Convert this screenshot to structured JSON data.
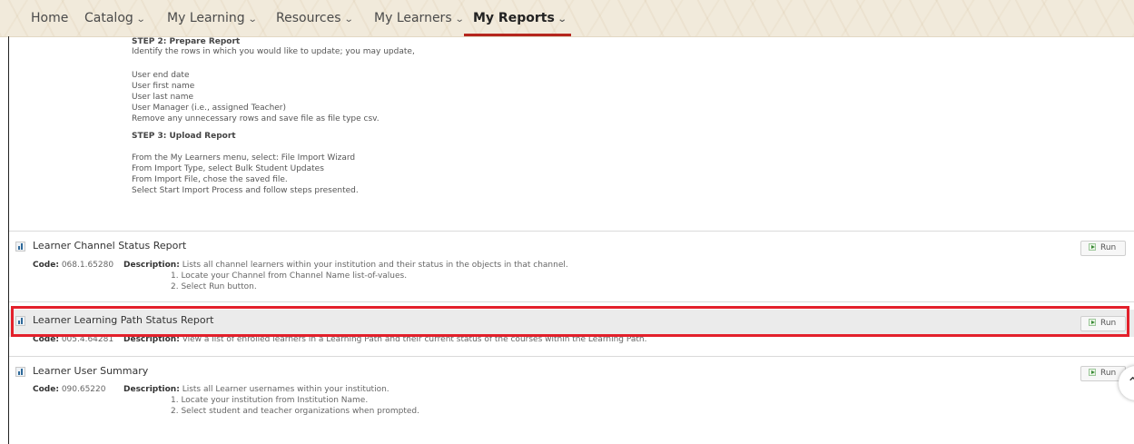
{
  "nav": {
    "items": [
      {
        "label": "Home",
        "dropdown": false,
        "active": false
      },
      {
        "label": "Catalog",
        "dropdown": true,
        "active": false
      },
      {
        "label": "My Learning",
        "dropdown": true,
        "active": false
      },
      {
        "label": "Resources",
        "dropdown": true,
        "active": false
      },
      {
        "label": "My Learners",
        "dropdown": true,
        "active": false
      },
      {
        "label": "My Reports",
        "dropdown": true,
        "active": true
      }
    ],
    "chevron": "⌄",
    "accent_color": "#b5261e"
  },
  "instructions": {
    "step2_title": "STEP 2: Prepare Report",
    "step2_intro": "Identify the rows in which you would like to update; you may update,",
    "fields": [
      "User end date",
      "User first name",
      "User last name",
      "User Manager (i.e., assigned Teacher)"
    ],
    "step2_outro": "Remove any unnecessary rows and save file as file type csv.",
    "step3_title": "STEP 3: Upload Report",
    "step3_lines": [
      "From the My Learners menu, select: File Import Wizard",
      "From Import Type, select Bulk Student Updates",
      "From Import File, chose the saved file.",
      "Select Start Import Process and follow steps presented."
    ]
  },
  "labels": {
    "code": "Code:",
    "description": "Description:",
    "run": "Run"
  },
  "reports": [
    {
      "title": "Learner Channel Status Report",
      "code": "068.1.65280",
      "description": "Lists all channel learners within your institution and their status in the objects in that channel.",
      "steps": [
        "1. Locate your Channel from Channel Name list-of-values.",
        "2. Select Run button."
      ],
      "highlighted": false
    },
    {
      "title": "Learner Learning Path Status Report",
      "code": "005.4.64281",
      "description": "View a list of enrolled learners in a Learning Path and their current status of the courses within the Learning Path.",
      "steps": [],
      "highlighted": true
    },
    {
      "title": "Learner User Summary",
      "code": "090.65220",
      "description": "Lists all Learner usernames within your institution.",
      "steps": [
        "1. Locate your institution from Institution Name.",
        "2. Select student and teacher organizations when prompted."
      ],
      "highlighted": false
    }
  ],
  "icons": {
    "report": "report-chart-icon",
    "run": "play-icon",
    "scroll_top": "chevron-up-icon"
  },
  "colors": {
    "highlight_border": "#e3202b",
    "highlight_row": "#ebebeb"
  }
}
